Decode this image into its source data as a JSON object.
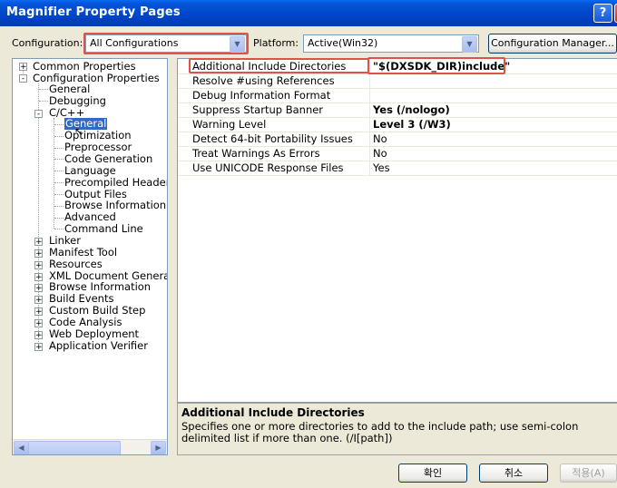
{
  "window": {
    "title": "Magnifier Property Pages",
    "help_glyph": "?",
    "close_glyph": "×"
  },
  "config_row": {
    "configuration_label": "Configuration:",
    "configuration_value": "All Configurations",
    "platform_label": "Platform:",
    "platform_value": "Active(Win32)",
    "config_manager_label": "Configuration Manager..."
  },
  "tree": {
    "items": [
      {
        "label": "Common Properties",
        "expander": "+"
      },
      {
        "label": "Configuration Properties",
        "expander": "-"
      },
      {
        "label": "General"
      },
      {
        "label": "Debugging"
      },
      {
        "label": "C/C++",
        "expander": "-"
      },
      {
        "label": "General",
        "selected": true
      },
      {
        "label": "Optimization"
      },
      {
        "label": "Preprocessor"
      },
      {
        "label": "Code Generation"
      },
      {
        "label": "Language"
      },
      {
        "label": "Precompiled Headers"
      },
      {
        "label": "Output Files"
      },
      {
        "label": "Browse Information"
      },
      {
        "label": "Advanced"
      },
      {
        "label": "Command Line"
      },
      {
        "label": "Linker",
        "expander": "+"
      },
      {
        "label": "Manifest Tool",
        "expander": "+"
      },
      {
        "label": "Resources",
        "expander": "+"
      },
      {
        "label": "XML Document Generator",
        "expander": "+"
      },
      {
        "label": "Browse Information",
        "expander": "+"
      },
      {
        "label": "Build Events",
        "expander": "+"
      },
      {
        "label": "Custom Build Step",
        "expander": "+"
      },
      {
        "label": "Code Analysis",
        "expander": "+"
      },
      {
        "label": "Web Deployment",
        "expander": "+"
      },
      {
        "label": "Application Verifier",
        "expander": "+"
      }
    ],
    "scroll_left": "◀",
    "scroll_right": "▶"
  },
  "properties": {
    "rows": [
      {
        "name": "Additional Include Directories",
        "value": "\"$(DXSDK_DIR)include\"",
        "bold": true
      },
      {
        "name": "Resolve #using References",
        "value": ""
      },
      {
        "name": "Debug Information Format",
        "value": ""
      },
      {
        "name": "Suppress Startup Banner",
        "value": "Yes (/nologo)",
        "bold": true
      },
      {
        "name": "Warning Level",
        "value": "Level 3 (/W3)",
        "bold": true
      },
      {
        "name": "Detect 64-bit Portability Issues",
        "value": "No"
      },
      {
        "name": "Treat Warnings As Errors",
        "value": "No"
      },
      {
        "name": "Use UNICODE Response Files",
        "value": "Yes"
      }
    ]
  },
  "description": {
    "title": "Additional Include Directories",
    "text": "Specifies one or more directories to add to the include path; use semi-colon delimited list if more than one.     (/I[path])"
  },
  "buttons": {
    "ok": "확인",
    "cancel": "취소",
    "apply": "적용(A)"
  },
  "colors": {
    "titlebar": "#0453d6",
    "highlight_box": "#e0514a",
    "selection": "#316ac5",
    "dialog_bg": "#ece9d8"
  }
}
